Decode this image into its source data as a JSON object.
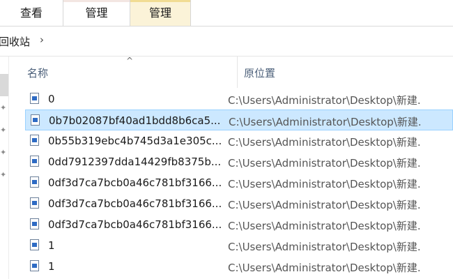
{
  "ribbon": {
    "tabs": [
      {
        "label": "查看"
      },
      {
        "label": "管理"
      },
      {
        "label": "管理"
      }
    ]
  },
  "address": {
    "crumb": "回收站",
    "separator": "›"
  },
  "columns": {
    "name": "名称",
    "original_location": "原位置",
    "sort_indicator": "^"
  },
  "files": [
    {
      "name": "0",
      "location": "C:\\Users\\Administrator\\Desktop\\新建.",
      "selected": false
    },
    {
      "name": "0b7b02087bf40ad1bdd8b6ca5...",
      "location": "C:\\Users\\Administrator\\Desktop\\新建.",
      "selected": true
    },
    {
      "name": "0b55b319ebc4b745d3a1e305c...",
      "location": "C:\\Users\\Administrator\\Desktop\\新建.",
      "selected": false
    },
    {
      "name": "0dd7912397dda14429fb8375b...",
      "location": "C:\\Users\\Administrator\\Desktop\\新建.",
      "selected": false
    },
    {
      "name": "0df3d7ca7bcb0a46c781bf3166...",
      "location": "C:\\Users\\Administrator\\Desktop\\新建.",
      "selected": false
    },
    {
      "name": "0df3d7ca7bcb0a46c781bf3166...",
      "location": "C:\\Users\\Administrator\\Desktop\\新建.",
      "selected": false
    },
    {
      "name": "0df3d7ca7bcb0a46c781bf3166...",
      "location": "C:\\Users\\Administrator\\Desktop\\新建.",
      "selected": false
    },
    {
      "name": "1",
      "location": "C:\\Users\\Administrator\\Desktop\\新建.",
      "selected": false
    },
    {
      "name": "1",
      "location": "C:\\Users\\Administrator\\Desktop\\新建.",
      "selected": false
    }
  ],
  "icons": {
    "file": "image-file-icon",
    "pin": "pin-icon"
  },
  "colors": {
    "selection_bg": "#cce8ff",
    "selection_border": "#99d1ff",
    "manage_tab_highlight": "#fbf3d8"
  }
}
